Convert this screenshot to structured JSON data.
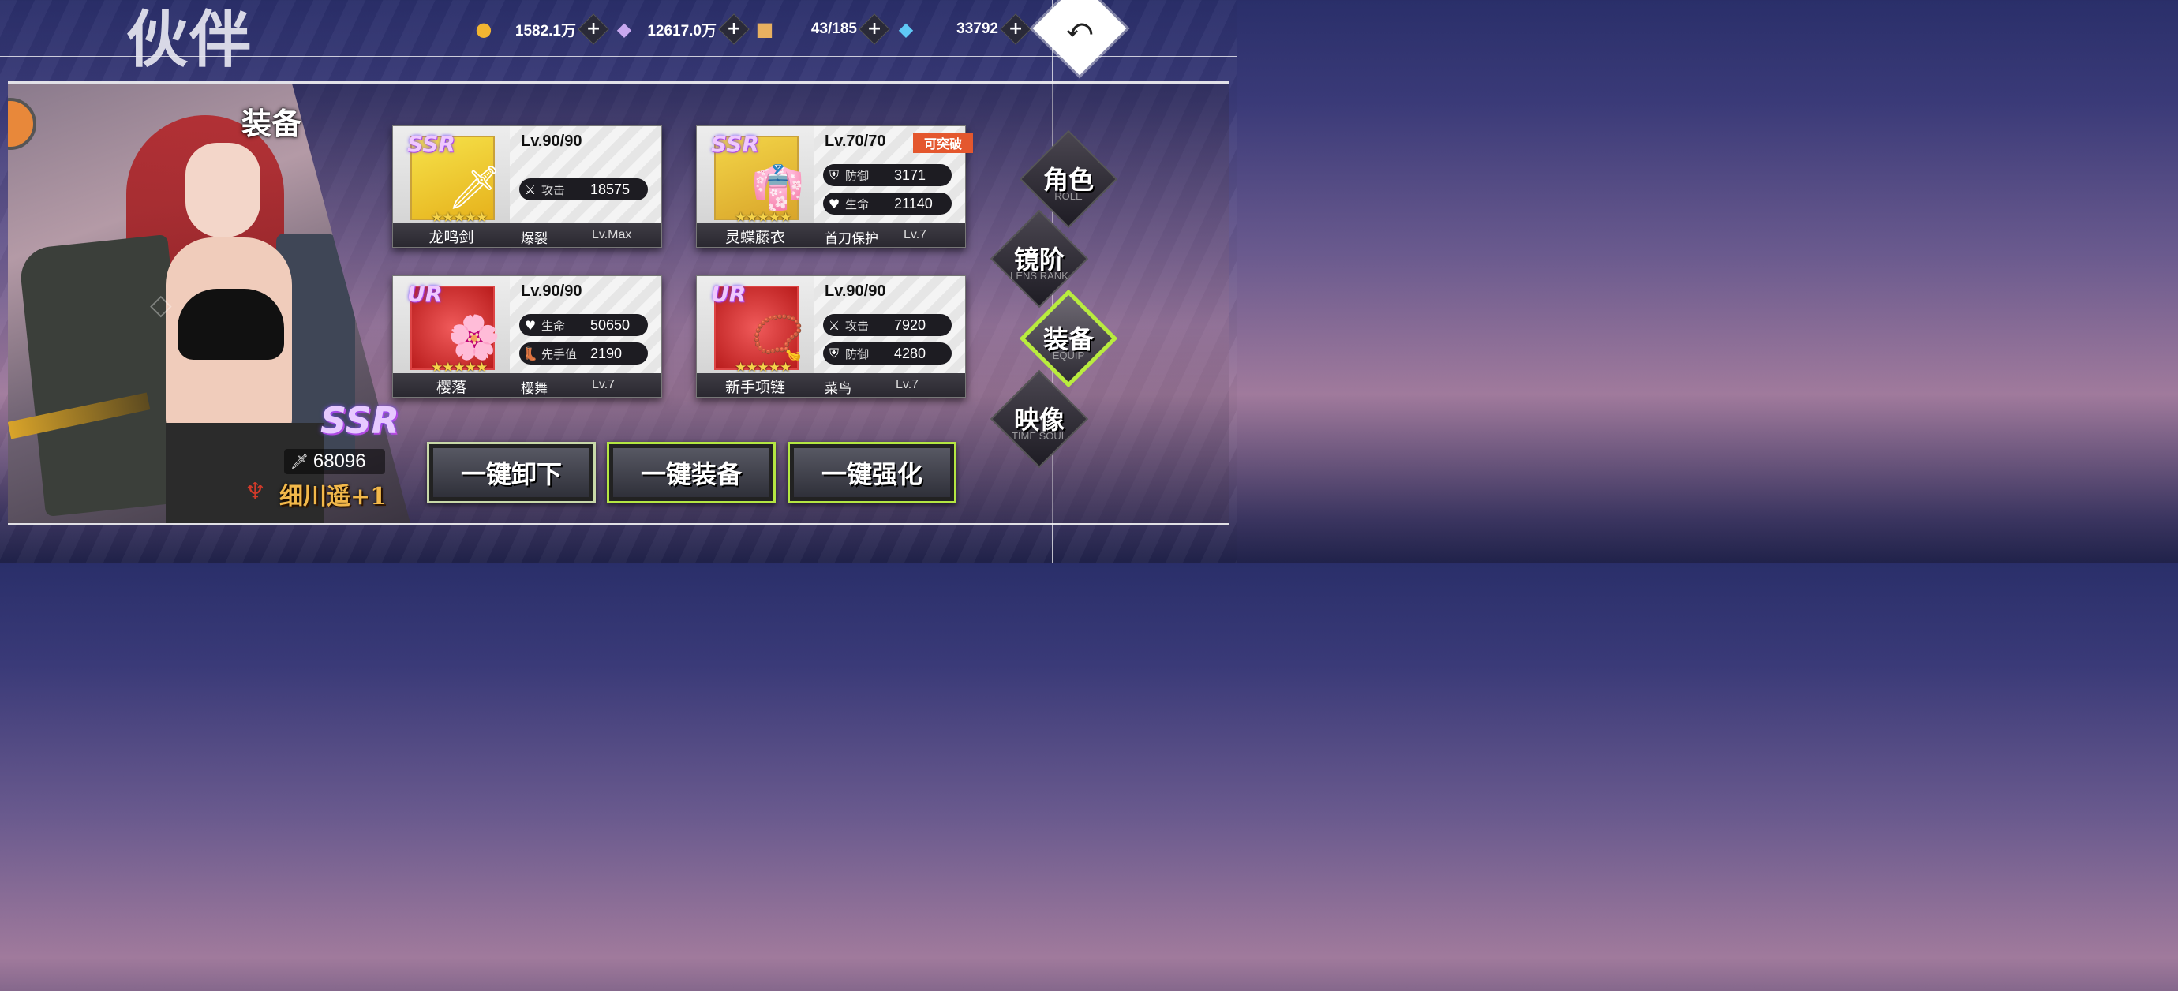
{
  "page_title": "伙伴",
  "resources": [
    {
      "icon": "gold-coin-icon",
      "value": "1582.1万"
    },
    {
      "icon": "crystal-icon",
      "value": "12617.0万"
    },
    {
      "icon": "chest-icon",
      "value": "43/185"
    },
    {
      "icon": "diamond-icon",
      "value": "33792"
    }
  ],
  "plus_label": "+",
  "back_label": "⤺",
  "section_title": "装备",
  "character": {
    "rarity": "SSR",
    "power": "68096",
    "name": "细川遥+1"
  },
  "equipment": [
    {
      "rarity": "SSR",
      "name": "龙鸣剑",
      "level": "Lv.90/90",
      "stats": [
        {
          "label": "攻击",
          "value": "18575",
          "icon": "sword-cross-icon"
        }
      ],
      "skill": "爆裂",
      "skill_level": "Lv.Max",
      "stars": "★★★★★",
      "glyph": "🗡"
    },
    {
      "rarity": "SSR",
      "name": "灵蝶藤衣",
      "level": "Lv.70/70",
      "badge": "可突破",
      "stats": [
        {
          "label": "防御",
          "value": "3171",
          "icon": "shield-icon"
        },
        {
          "label": "生命",
          "value": "21140",
          "icon": "heart-icon"
        }
      ],
      "skill": "首刀保护",
      "skill_level": "Lv.7",
      "stars": "★★★★★",
      "glyph": "👘"
    },
    {
      "rarity": "UR",
      "name": "樱落",
      "level": "Lv.90/90",
      "stats": [
        {
          "label": "生命",
          "value": "50650",
          "icon": "heart-icon"
        },
        {
          "label": "先手值",
          "value": "2190",
          "icon": "boot-icon"
        }
      ],
      "skill": "樱舞",
      "skill_level": "Lv.7",
      "stars": "★★★★★",
      "glyph": "🌸"
    },
    {
      "rarity": "UR",
      "name": "新手项链",
      "level": "Lv.90/90",
      "stats": [
        {
          "label": "攻击",
          "value": "7920",
          "icon": "sword-cross-icon"
        },
        {
          "label": "防御",
          "value": "4280",
          "icon": "shield-icon"
        }
      ],
      "skill": "菜鸟",
      "skill_level": "Lv.7",
      "stars": "★★★★★",
      "glyph": "📿"
    }
  ],
  "actions": {
    "unequip_all": "一键卸下",
    "equip_all": "一键装备",
    "enhance_all": "一键强化"
  },
  "nav": [
    {
      "cn": "角色",
      "en": "ROLE"
    },
    {
      "cn": "镜阶",
      "en": "LENS RANK"
    },
    {
      "cn": "装备",
      "en": "EQUIP",
      "active": true
    },
    {
      "cn": "映像",
      "en": "TIME SOUL"
    }
  ],
  "colors": {
    "accent_green": "#b8ec3e",
    "badge_orange": "#e4572e"
  }
}
